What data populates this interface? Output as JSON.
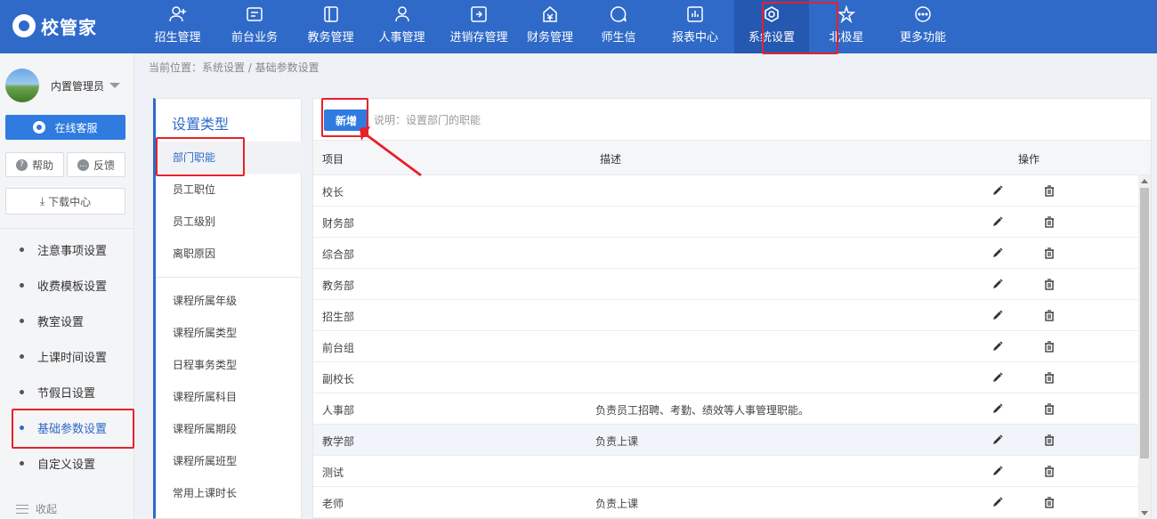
{
  "app": {
    "logo_text": "校管家"
  },
  "nav": [
    {
      "label": "招生管理",
      "icon": "person-add-icon"
    },
    {
      "label": "前台业务",
      "icon": "front-desk-icon"
    },
    {
      "label": "教务管理",
      "icon": "book-icon"
    },
    {
      "label": "人事管理",
      "icon": "person-icon"
    },
    {
      "label": "进销存管理",
      "icon": "inventory-icon"
    },
    {
      "label": "财务管理",
      "icon": "finance-icon"
    },
    {
      "label": "师生信",
      "icon": "message-icon"
    },
    {
      "label": "报表中心",
      "icon": "report-icon"
    },
    {
      "label": "系统设置",
      "icon": "settings-icon",
      "active": true
    },
    {
      "label": "北极星",
      "icon": "star-icon"
    },
    {
      "label": "更多功能",
      "icon": "more-icon"
    }
  ],
  "sidebar": {
    "user_name": "内置管理员",
    "service_label": "在线客服",
    "help_label": "帮助",
    "feedback_label": "反馈",
    "download_label": "下载中心",
    "items": [
      {
        "label": "注意事项设置"
      },
      {
        "label": "收费模板设置"
      },
      {
        "label": "教室设置"
      },
      {
        "label": "上课时间设置"
      },
      {
        "label": "节假日设置"
      },
      {
        "label": "基础参数设置",
        "active": true
      },
      {
        "label": "自定义设置"
      }
    ],
    "collapse_label": "收起"
  },
  "breadcrumb": "当前位置：系统设置 / 基础参数设置",
  "type_panel": {
    "title": "设置类型",
    "group1": [
      "部门职能",
      "员工职位",
      "员工级别",
      "离职原因"
    ],
    "group2": [
      "课程所属年级",
      "课程所属类型",
      "日程事务类型",
      "课程所属科目",
      "课程所属期段",
      "课程所属班型",
      "常用上课时长"
    ]
  },
  "main": {
    "add_label": "新增",
    "description_note": "说明：设置部门的职能",
    "columns": {
      "item": "项目",
      "description": "描述",
      "actions": "操作"
    },
    "rows": [
      {
        "item": "校长",
        "description": ""
      },
      {
        "item": "财务部",
        "description": ""
      },
      {
        "item": "综合部",
        "description": ""
      },
      {
        "item": "教务部",
        "description": ""
      },
      {
        "item": "招生部",
        "description": ""
      },
      {
        "item": "前台组",
        "description": ""
      },
      {
        "item": "副校长",
        "description": ""
      },
      {
        "item": "人事部",
        "description": "负责员工招聘、考勤、绩效等人事管理职能。"
      },
      {
        "item": "教学部",
        "description": "负责上课"
      },
      {
        "item": "测试",
        "description": ""
      },
      {
        "item": "老师",
        "description": "负责上课"
      }
    ]
  },
  "colors": {
    "brand": "#2f6ac8",
    "annotation": "#e8202a"
  }
}
